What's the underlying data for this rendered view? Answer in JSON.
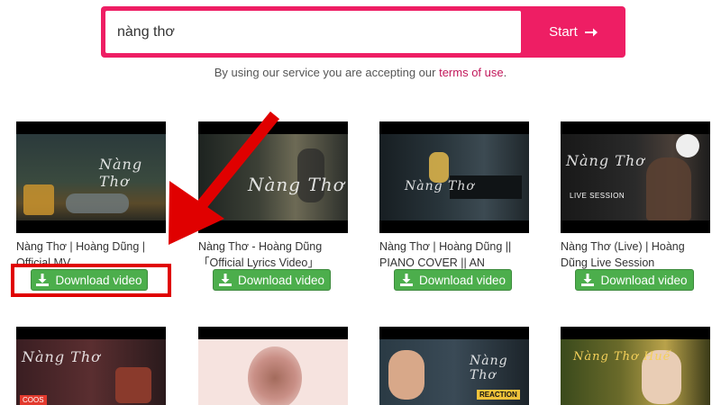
{
  "search": {
    "value": "nàng thơ",
    "start_label": "Start"
  },
  "terms": {
    "prefix": "By using our service you are accepting our ",
    "link": "terms of use",
    "suffix": "."
  },
  "results": [
    {
      "title": "Nàng Thơ | Hoàng Dũng | Official MV",
      "download_label": "Download video",
      "thumb_text": "Nàng Thơ"
    },
    {
      "title": "Nàng Thơ - Hoàng Dũng 「Official Lyrics Video」",
      "download_label": "Download video",
      "thumb_text": "Nàng Thơ"
    },
    {
      "title": "Nàng Thơ | Hoàng Dũng || PIANO COVER || AN",
      "download_label": "Download video",
      "thumb_text": "Nàng Thơ"
    },
    {
      "title": "Nàng Thơ (Live) | Hoàng Dũng Live Session",
      "download_label": "Download video",
      "thumb_text": "Nàng Thơ",
      "thumb_sub": "LIVE SESSION"
    }
  ],
  "results_row2": [
    {
      "thumb_text": "Nàng Thơ",
      "badge": "COOS"
    },
    {
      "thumb_text": ""
    },
    {
      "thumb_text": "Nàng Thơ",
      "badge": "REACTION"
    },
    {
      "thumb_text": "Nàng Thơ Huế"
    }
  ],
  "colors": {
    "accent": "#ee1e64",
    "download_green": "#4cae4c",
    "annotation_red": "#e00000"
  }
}
